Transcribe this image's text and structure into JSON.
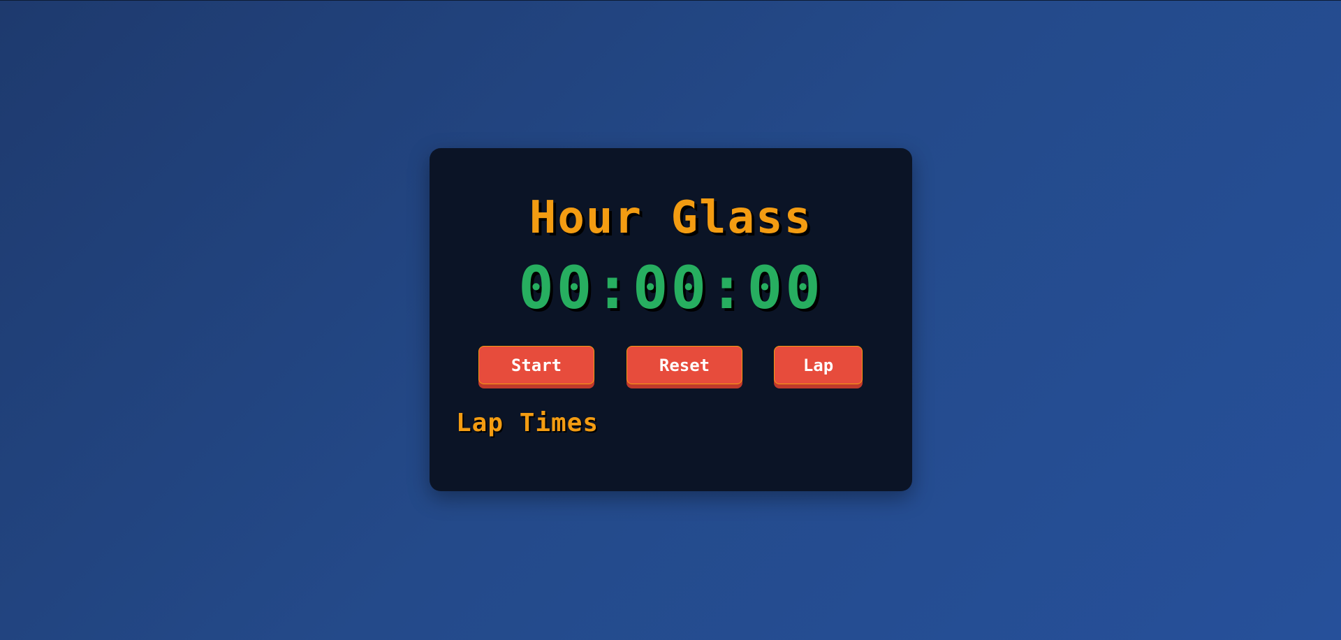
{
  "app": {
    "title": "Hour Glass"
  },
  "timer": {
    "display": "00:00:00"
  },
  "controls": {
    "start_label": "Start",
    "reset_label": "Reset",
    "lap_label": "Lap"
  },
  "laps": {
    "heading": "Lap Times",
    "items": []
  },
  "colors": {
    "background_start": "#1e3a6e",
    "background_end": "#26509a",
    "card": "#0b1426",
    "title": "#f39c12",
    "timer": "#27ae60",
    "button": "#e74c3c",
    "button_border": "#f39c12",
    "button_text": "#ffffff"
  }
}
